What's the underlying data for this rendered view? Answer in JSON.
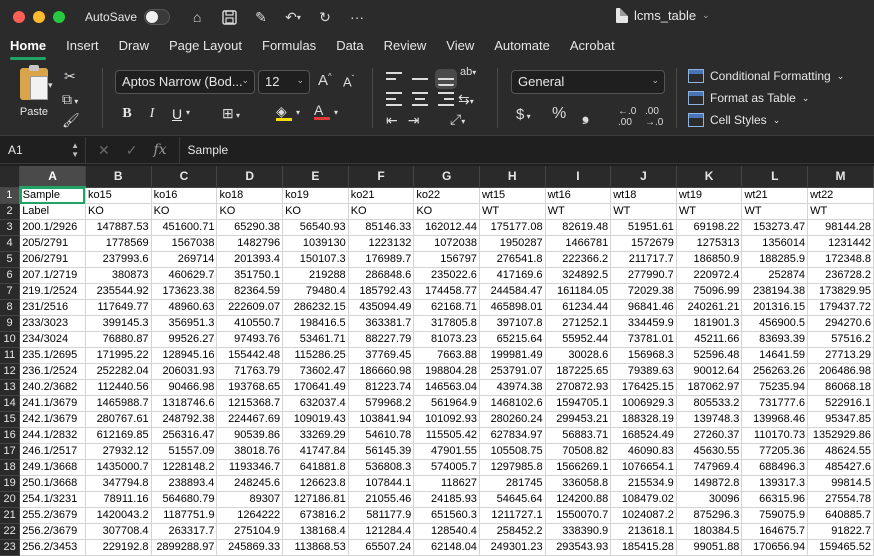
{
  "titlebar": {
    "autosave_label": "AutoSave",
    "doc_title": "lcms_table"
  },
  "tabs": [
    "Home",
    "Insert",
    "Draw",
    "Page Layout",
    "Formulas",
    "Data",
    "Review",
    "View",
    "Automate",
    "Acrobat"
  ],
  "ribbon": {
    "paste_label": "Paste",
    "font_name": "Aptos Narrow (Bod...",
    "font_size": "12",
    "number_format": "General",
    "conditional_formatting": "Conditional Formatting",
    "format_as_table": "Format as Table",
    "cell_styles": "Cell Styles",
    "bold": "B",
    "italic": "I",
    "underline": "U",
    "font_color": "#e03a3a",
    "highlight_color": "#f5d90a"
  },
  "formula_bar": {
    "cell_ref": "A1",
    "fx": "fx",
    "value": "Sample"
  },
  "sheet": {
    "columns": [
      "A",
      "B",
      "C",
      "D",
      "E",
      "F",
      "G",
      "H",
      "I",
      "J",
      "K",
      "L",
      "M"
    ],
    "rows": [
      {
        "n": "1",
        "cells": [
          "Sample",
          "ko15",
          "ko16",
          "ko18",
          "ko19",
          "ko21",
          "ko22",
          "wt15",
          "wt16",
          "wt18",
          "wt19",
          "wt21",
          "wt22"
        ]
      },
      {
        "n": "2",
        "cells": [
          "Label",
          "KO",
          "KO",
          "KO",
          "KO",
          "KO",
          "KO",
          "WT",
          "WT",
          "WT",
          "WT",
          "WT",
          "WT"
        ]
      },
      {
        "n": "3",
        "cells": [
          "200.1/2926",
          "147887.53",
          "451600.71",
          "65290.38",
          "56540.93",
          "85146.33",
          "162012.44",
          "175177.08",
          "82619.48",
          "51951.61",
          "69198.22",
          "153273.47",
          "98144.28"
        ]
      },
      {
        "n": "4",
        "cells": [
          "205/2791",
          "1778569",
          "1567038",
          "1482796",
          "1039130",
          "1223132",
          "1072038",
          "1950287",
          "1466781",
          "1572679",
          "1275313",
          "1356014",
          "1231442"
        ]
      },
      {
        "n": "5",
        "cells": [
          "206/2791",
          "237993.6",
          "269714",
          "201393.4",
          "150107.3",
          "176989.7",
          "156797",
          "276541.8",
          "222366.2",
          "211717.7",
          "186850.9",
          "188285.9",
          "172348.8"
        ]
      },
      {
        "n": "6",
        "cells": [
          "207.1/2719",
          "380873",
          "460629.7",
          "351750.1",
          "219288",
          "286848.6",
          "235022.6",
          "417169.6",
          "324892.5",
          "277990.7",
          "220972.4",
          "252874",
          "236728.2"
        ]
      },
      {
        "n": "7",
        "cells": [
          "219.1/2524",
          "235544.92",
          "173623.38",
          "82364.59",
          "79480.4",
          "185792.43",
          "174458.77",
          "244584.47",
          "161184.05",
          "72029.38",
          "75096.99",
          "238194.38",
          "173829.95"
        ]
      },
      {
        "n": "8",
        "cells": [
          "231/2516",
          "117649.77",
          "48960.63",
          "222609.07",
          "286232.15",
          "435094.49",
          "62168.71",
          "465898.01",
          "61234.44",
          "96841.46",
          "240261.21",
          "201316.15",
          "179437.72"
        ]
      },
      {
        "n": "9",
        "cells": [
          "233/3023",
          "399145.3",
          "356951.3",
          "410550.7",
          "198416.5",
          "363381.7",
          "317805.8",
          "397107.8",
          "271252.1",
          "334459.9",
          "181901.3",
          "456900.5",
          "294270.6"
        ]
      },
      {
        "n": "10",
        "cells": [
          "234/3024",
          "76880.87",
          "99526.27",
          "97493.76",
          "53461.71",
          "88227.79",
          "81073.23",
          "65215.64",
          "55952.44",
          "73781.01",
          "45211.66",
          "83693.39",
          "57516.2"
        ]
      },
      {
        "n": "11",
        "cells": [
          "235.1/2695",
          "171995.22",
          "128945.16",
          "155442.48",
          "115286.25",
          "37769.45",
          "7663.88",
          "199981.49",
          "30028.6",
          "156968.3",
          "52596.48",
          "14641.59",
          "27713.29"
        ]
      },
      {
        "n": "12",
        "cells": [
          "236.1/2524",
          "252282.04",
          "206031.93",
          "71763.79",
          "73602.47",
          "186660.98",
          "198804.28",
          "253791.07",
          "187225.65",
          "79389.63",
          "90012.64",
          "256263.26",
          "206486.98"
        ]
      },
      {
        "n": "13",
        "cells": [
          "240.2/3682",
          "112440.56",
          "90466.98",
          "193768.65",
          "170641.49",
          "81223.74",
          "146563.04",
          "43974.38",
          "270872.93",
          "176425.15",
          "187062.97",
          "75235.94",
          "86068.18"
        ]
      },
      {
        "n": "14",
        "cells": [
          "241.1/3679",
          "1465988.7",
          "1318746.6",
          "1215368.7",
          "632037.4",
          "579968.2",
          "561964.9",
          "1468102.6",
          "1594705.1",
          "1006929.3",
          "805533.2",
          "731777.6",
          "522916.1"
        ]
      },
      {
        "n": "15",
        "cells": [
          "242.1/3679",
          "280767.61",
          "248792.38",
          "224467.69",
          "109019.43",
          "103841.94",
          "101092.93",
          "280260.24",
          "299453.21",
          "188328.19",
          "139748.3",
          "139968.46",
          "95347.85"
        ]
      },
      {
        "n": "16",
        "cells": [
          "244.1/2832",
          "612169.85",
          "256316.47",
          "90539.86",
          "33269.29",
          "54610.78",
          "115505.42",
          "627834.97",
          "56883.71",
          "168524.49",
          "27260.37",
          "110170.73",
          "1352929.86"
        ]
      },
      {
        "n": "17",
        "cells": [
          "246.1/2517",
          "27932.12",
          "51557.09",
          "38018.76",
          "41747.84",
          "56145.39",
          "47901.55",
          "105508.75",
          "70508.82",
          "46090.83",
          "45630.55",
          "77205.36",
          "48624.55"
        ]
      },
      {
        "n": "18",
        "cells": [
          "249.1/3668",
          "1435000.7",
          "1228148.2",
          "1193346.7",
          "641881.8",
          "536808.3",
          "574005.7",
          "1297985.8",
          "1566269.1",
          "1076654.1",
          "747969.4",
          "688496.3",
          "485427.6"
        ]
      },
      {
        "n": "19",
        "cells": [
          "250.1/3668",
          "347794.8",
          "238893.4",
          "248245.6",
          "126623.8",
          "107844.1",
          "118627",
          "281745",
          "336058.8",
          "215534.9",
          "149872.8",
          "139317.3",
          "99814.5"
        ]
      },
      {
        "n": "20",
        "cells": [
          "254.1/3231",
          "78911.16",
          "564680.79",
          "89307",
          "127186.81",
          "21055.46",
          "24185.93",
          "54645.64",
          "124200.88",
          "108479.02",
          "30096",
          "66315.96",
          "27554.78"
        ]
      },
      {
        "n": "21",
        "cells": [
          "255.2/3679",
          "1420043.2",
          "1187751.9",
          "1264222",
          "673816.2",
          "581177.9",
          "651560.3",
          "1211727.1",
          "1550070.7",
          "1024087.2",
          "875296.3",
          "759075.9",
          "640885.7"
        ]
      },
      {
        "n": "22",
        "cells": [
          "256.2/3679",
          "307708.4",
          "263317.7",
          "275104.9",
          "138168.4",
          "121284.4",
          "128540.4",
          "258452.2",
          "338390.9",
          "213618.1",
          "180384.5",
          "164675.7",
          "91822.7"
        ]
      },
      {
        "n": "23",
        "cells": [
          "256.2/3453",
          "229192.8",
          "2899288.97",
          "245869.33",
          "113868.53",
          "65507.24",
          "62148.04",
          "249301.23",
          "293543.93",
          "185415.28",
          "99051.88",
          "170656.94",
          "159465.52"
        ]
      }
    ]
  }
}
